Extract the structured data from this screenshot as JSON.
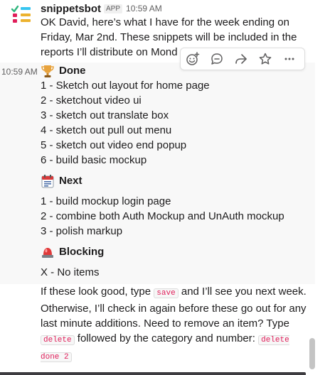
{
  "message": {
    "sender": "snippetsbot",
    "badge": "APP",
    "time": "10:59 AM",
    "intro": "OK David, here’s what I have for the week ending on Friday, Mar 2nd. These snippets will be included in the reports I’ll distribute on Mond"
  },
  "gutter_time": "10:59 AM",
  "done": {
    "title": "Done",
    "items": [
      "1 - Sketch out layout for home page",
      "2 - sketchout video ui",
      "3 - sketch out translate box",
      "4 - sketch out pull out menu",
      "5 - sketch out video end popup",
      "6 - build basic mockup"
    ]
  },
  "next": {
    "title": "Next",
    "items": [
      "1 - build mockup login page",
      "2 - combine both Auth Mockup and UnAuth mockup",
      "3 - polish markup"
    ]
  },
  "blocking": {
    "title": "Blocking",
    "items": [
      "X - No items"
    ]
  },
  "footer": {
    "t1": "If these look good, type ",
    "c1": "save",
    "t2": " and I’ll see you next week. Otherwise, I’ll check in again before these go out for any last minute additions. Need to remove an item? Type ",
    "c2": "delete",
    "t3": " followed by the category and number: ",
    "c3": "delete done 2"
  },
  "icons": {
    "avatar": "checklist-avatar",
    "done": "trophy-icon",
    "next": "calendar-icon",
    "blocking": "rotating-light-icon",
    "actions": [
      "add-reaction-icon",
      "reply-in-thread-icon",
      "share-message-icon",
      "save-star-icon",
      "more-actions-icon"
    ]
  },
  "colors": {
    "mention_code": "#e01e5a",
    "hover_bg": "#f8f8f8",
    "avatar_green": "#2eb67d",
    "avatar_red": "#e01e5a",
    "avatar_yellow": "#ecb22e",
    "avatar_blue": "#36c5f0"
  }
}
